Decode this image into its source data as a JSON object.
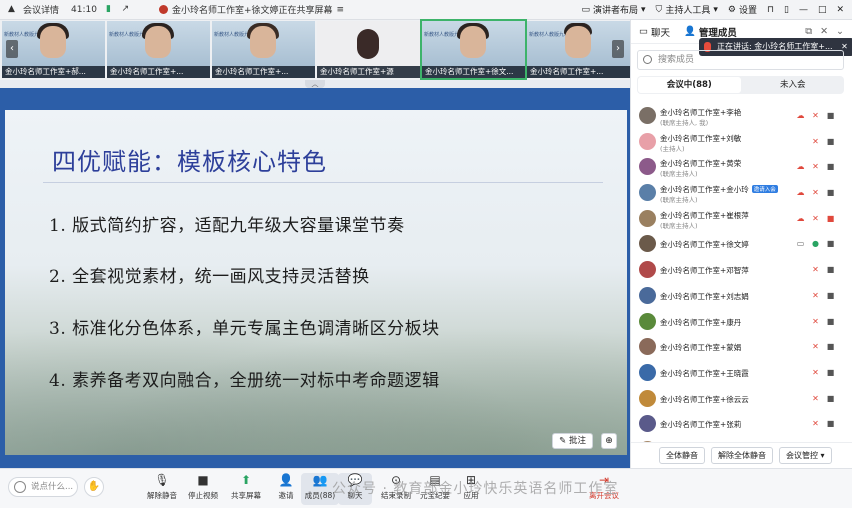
{
  "topbar": {
    "meeting_detail": "会议详情",
    "timer": "41:10",
    "share_title": "金小玲名师工作室+徐文婷正在共享屏幕",
    "presenter_layout": "演讲者布局",
    "host_tools": "主持人工具",
    "settings": "设置"
  },
  "thumbs": [
    {
      "name": "金小玲名师工作室+郝...",
      "banner": "新教材人教版九年级英语"
    },
    {
      "name": "金小玲名师工作室+...",
      "banner": "新教材人教版九年级英语"
    },
    {
      "name": "金小玲名师工作室+...",
      "banner": "新教材人教版九年级英语"
    },
    {
      "name": "金小玲名师工作室+源",
      "banner": ""
    },
    {
      "name": "金小玲名师工作室+徐文...",
      "banner": "新教材人教版九年级英语"
    },
    {
      "name": "金小玲名师工作室+...",
      "banner": "新教材人教版九年级英语"
    }
  ],
  "slide": {
    "title": "四优赋能：模板核心特色",
    "points": [
      "1.  版式简约扩容，适配九年级大容量课堂节奏",
      "2.  全套视觉素材，统一画风支持灵活替换",
      "3.  标准化分色体系，单元专属主色调清晰区分板块",
      "4.  素养备考双向融合，全册统一对标中考命题逻辑"
    ],
    "annotate": "批注"
  },
  "toolbar": {
    "chat_placeholder": "说点什么...",
    "unmute": "解除静音",
    "stop_video": "停止视频",
    "share": "共享屏幕",
    "invite": "邀请",
    "members": "成员(88)",
    "chat": "聊天",
    "end_record": "结束录制",
    "cloud_minutes": "元宝纪要",
    "apps": "应用",
    "leave": "离开会议",
    "watermark": "公众号 · 教育部金小玲快乐英语名师工作室"
  },
  "panel": {
    "tab_chat": "聊天",
    "tab_members": "管理成员",
    "speaking": "正在讲话: 金小玲名师工作室+...",
    "search_placeholder": "搜索成员",
    "seg_in_meeting": "会议中(88)",
    "seg_not_joined": "未入会",
    "mute_all": "全体静音",
    "unmute_all": "解除全体静音",
    "meeting_control": "会议管控",
    "members": [
      {
        "name": "金小玲名师工作室+李艳",
        "role": "(联席主持人, 我)",
        "color": "#7a6f66",
        "icons": [
          "share",
          "mic-off",
          "cam"
        ]
      },
      {
        "name": "金小玲名师工作室+刘敏",
        "role": "(主持人)",
        "color": "#e8a0a8",
        "icons": [
          "mic-off",
          "cam"
        ]
      },
      {
        "name": "金小玲名师工作室+黄荣",
        "role": "(联席主持人)",
        "color": "#8c5a8a",
        "icons": [
          "share",
          "mic-off",
          "cam"
        ]
      },
      {
        "name": "金小玲名师工作室+金小玲",
        "role": "(联席主持人)",
        "badge": "邀请入会",
        "color": "#5a7fa8",
        "icons": [
          "share",
          "mic-off",
          "cam"
        ]
      },
      {
        "name": "金小玲名师工作室+崔根萍",
        "role": "(联席主持人)",
        "color": "#9a8060",
        "icons": [
          "share",
          "mic-off",
          "cam-off"
        ]
      },
      {
        "name": "金小玲名师工作室+徐文婷",
        "role": "",
        "color": "#6b5a4a",
        "icons": [
          "screen",
          "mic-on",
          "cam"
        ]
      },
      {
        "name": "金小玲名师工作室+邓智萍",
        "role": "",
        "color": "#b04a4a",
        "icons": [
          "mic-off",
          "cam"
        ]
      },
      {
        "name": "金小玲名师工作室+刘志娟",
        "role": "",
        "color": "#4a6a9a",
        "icons": [
          "mic-off",
          "cam"
        ]
      },
      {
        "name": "金小玲名师工作室+康丹",
        "role": "",
        "color": "#5a8a3a",
        "icons": [
          "mic-off",
          "cam"
        ]
      },
      {
        "name": "金小玲名师工作室+蒙娟",
        "role": "",
        "color": "#8a6a5a",
        "icons": [
          "mic-off",
          "cam"
        ]
      },
      {
        "name": "金小玲名师工作室+王晓霞",
        "role": "",
        "color": "#3a6aa8",
        "icons": [
          "mic-off",
          "cam"
        ]
      },
      {
        "name": "金小玲名师工作室+徐云云",
        "role": "",
        "color": "#c08a3a",
        "icons": [
          "mic-off",
          "cam"
        ]
      },
      {
        "name": "金小玲名师工作室+张莉",
        "role": "",
        "color": "#5a5a8a",
        "icons": [
          "mic-off",
          "cam"
        ]
      },
      {
        "name": "钟昭娟",
        "role": "",
        "color": "#a88a6a",
        "icons": [
          "mic-off",
          "cam"
        ]
      },
      {
        "name": "新教材人教版九年级英语...",
        "role": "",
        "color": "#2c5ea8",
        "icons": [
          "mic-off",
          "cam"
        ]
      }
    ]
  }
}
